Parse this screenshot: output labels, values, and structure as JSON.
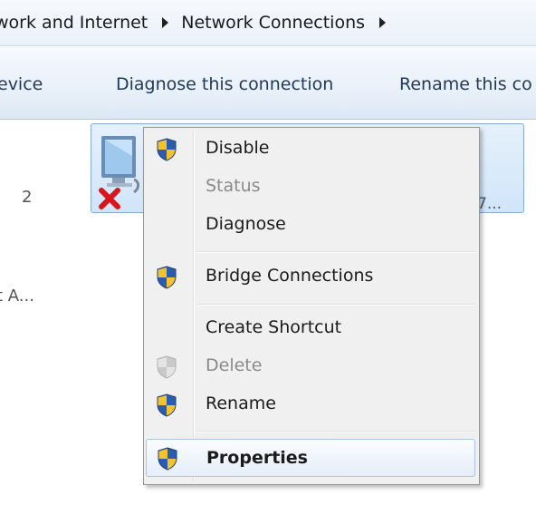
{
  "breadcrumb": {
    "items": [
      "work and Internet",
      "Network Connections"
    ]
  },
  "toolbar": {
    "device_label": "evice",
    "diagnose_label": "Diagnose this connection",
    "rename_label": "Rename this co"
  },
  "list": {
    "row1_text": "2",
    "row2_text": "t A...",
    "tile_right_text": "7..."
  },
  "context_menu": {
    "items": [
      {
        "label": "Disable",
        "shield": true,
        "state": "enabled"
      },
      {
        "label": "Status",
        "shield": false,
        "state": "disabled"
      },
      {
        "label": "Diagnose",
        "shield": false,
        "state": "enabled"
      },
      {
        "label": "Bridge Connections",
        "shield": true,
        "state": "enabled"
      },
      {
        "label": "Create Shortcut",
        "shield": false,
        "state": "enabled"
      },
      {
        "label": "Delete",
        "shield": true,
        "state": "disabled"
      },
      {
        "label": "Rename",
        "shield": true,
        "state": "enabled"
      },
      {
        "label": "Properties",
        "shield": true,
        "state": "default-highlighted"
      }
    ]
  },
  "icons": {
    "shield": "uac-shield-icon",
    "network": "network-adapter-icon",
    "disabled_mark": "red-x-icon"
  },
  "colors": {
    "shield_blue": "#2a5db0",
    "shield_yellow": "#f2c230",
    "red_x": "#d8161c",
    "selection_border": "#86abd9"
  }
}
